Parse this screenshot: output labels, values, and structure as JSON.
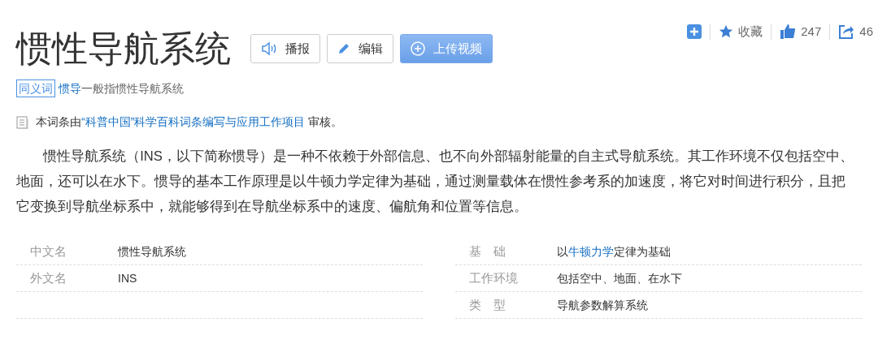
{
  "actions": [
    {
      "kind": "add"
    },
    {
      "kind": "star",
      "label": "收藏"
    },
    {
      "kind": "like",
      "label": "247"
    },
    {
      "kind": "share",
      "label": "46"
    }
  ],
  "title": "惯性导航系统",
  "buttons": [
    {
      "kind": "speaker",
      "label": "播报",
      "disabled": false
    },
    {
      "kind": "pencil",
      "label": "编辑",
      "disabled": false
    },
    {
      "kind": "upload",
      "label": "上传视频",
      "disabled": true
    }
  ],
  "synonym": {
    "badge": "同义词",
    "segments": [
      {
        "text": "惯导",
        "link": true
      },
      {
        "text": "一般指惯性导航系统",
        "link": false
      }
    ]
  },
  "review": {
    "segments": [
      {
        "text": "本词条由",
        "link": false
      },
      {
        "text": "“科普中国”科学百科词条编写与应用工作项目",
        "link": true
      },
      {
        "text": " 审核。",
        "link": false
      }
    ]
  },
  "summary": "惯性导航系统（INS，以下简称惯导）是一种不依赖于外部信息、也不向外部辐射能量的自主式导航系统。其工作环境不仅包括空中、地面，还可以在水下。惯导的基本工作原理是以牛顿力学定律为基础，通过测量载体在惯性参考系的加速度，将它对时间进行积分，且把它变换到导航坐标系中，就能够得到在导航坐标系中的速度、偏航角和位置等信息。",
  "info_left": [
    {
      "label": "中文名",
      "value": [
        {
          "text": "惯性导航系统",
          "link": false
        }
      ]
    },
    {
      "label": "外文名",
      "value": [
        {
          "text": "INS",
          "link": false
        }
      ]
    }
  ],
  "info_right": [
    {
      "label": "基　础",
      "value": [
        {
          "text": "以",
          "link": false
        },
        {
          "text": "牛顿力学",
          "link": true
        },
        {
          "text": "定律为基础",
          "link": false
        }
      ]
    },
    {
      "label": "工作环境",
      "value": [
        {
          "text": "包括空中、地面、在水下",
          "link": false
        }
      ]
    },
    {
      "label": "类　型",
      "value": [
        {
          "text": "导航参数解算系统",
          "link": false
        }
      ]
    }
  ]
}
